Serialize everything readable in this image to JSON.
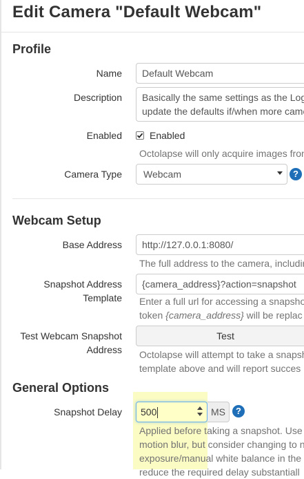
{
  "page": {
    "title": "Edit Camera \"Default Webcam\""
  },
  "profile": {
    "heading": "Profile",
    "name_label": "Name",
    "name_value": "Default Webcam",
    "description_label": "Description",
    "description_line1": "Basically the same settings as the Log",
    "description_line2": "update the defaults if/when more came",
    "enabled_label": "Enabled",
    "enabled_checkbox_label": "Enabled",
    "enabled_checked": true,
    "enabled_help": "Octolapse will only acquire images fron",
    "camera_type_label": "Camera Type",
    "camera_type_value": "Webcam"
  },
  "webcam_setup": {
    "heading": "Webcam Setup",
    "base_address_label": "Base Address",
    "base_address_value": "http://127.0.0.1:8080/",
    "base_address_help": "The full address to the camera, includir",
    "snapshot_label_line1": "Snapshot Address",
    "snapshot_label_line2": "Template",
    "snapshot_value": "{camera_address}?action=snapshot",
    "snapshot_help_line1": "Enter a full url for accessing a snapsho",
    "snapshot_help_line2_prefix": "token ",
    "snapshot_help_line2_token": "{camera_address}",
    "snapshot_help_line2_suffix": " will be replac",
    "test_label_line1": "Test Webcam Snapshot",
    "test_label_line2": "Address",
    "test_button": "Test",
    "test_help_line1": "Octolapse will attempt to take a snapsh",
    "test_help_line2": "template above and will report succes"
  },
  "general_options": {
    "heading": "General Options",
    "snapshot_delay_label": "Snapshot Delay",
    "snapshot_delay_value": "500",
    "snapshot_delay_unit": "MS",
    "delay_help_line1": "Applied before taking a snapshot. Use",
    "delay_help_line2": "motion blur, but consider changing to n",
    "delay_help_line3": "exposure/manual white balance in the",
    "delay_help_line4": "reduce the required delay substantiall"
  },
  "icons": {
    "help": "question-circle-icon",
    "help_glyph": "?"
  },
  "colors": {
    "help_icon": "#1e6fb8",
    "highlight": "#fbfbc4",
    "focus_border": "#66afe9"
  }
}
